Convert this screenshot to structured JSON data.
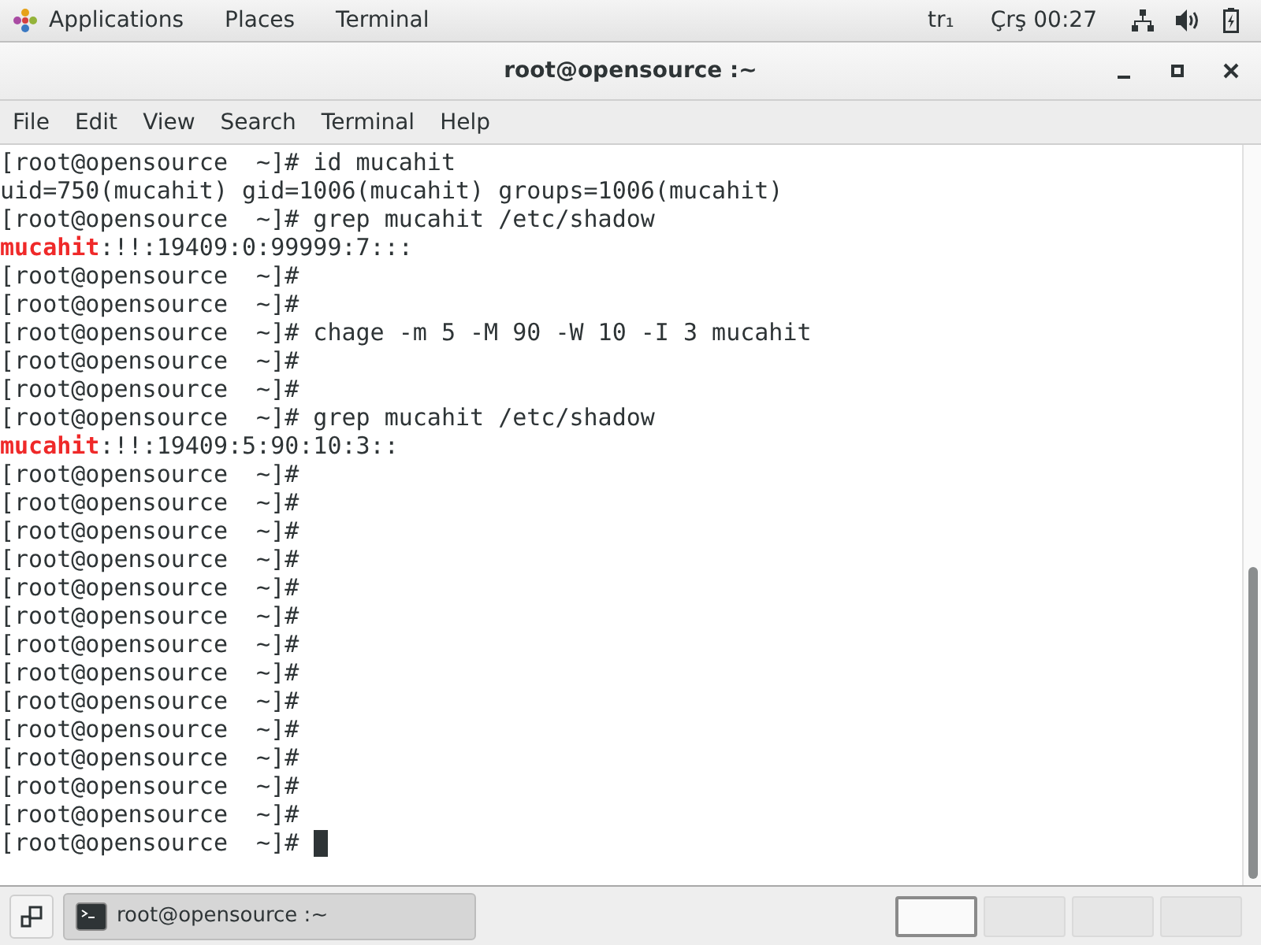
{
  "top_bar": {
    "menus": [
      "Applications",
      "Places",
      "Terminal"
    ],
    "keyboard": "tr₁",
    "clock": "Çrş 00:27"
  },
  "window": {
    "title": "root@opensource :~"
  },
  "menu_bar": [
    "File",
    "Edit",
    "View",
    "Search",
    "Terminal",
    "Help"
  ],
  "terminal": {
    "lines": [
      {
        "kind": "plain",
        "text": "[root@opensource  ~]# id mucahit"
      },
      {
        "kind": "plain",
        "text": "uid=750(mucahit) gid=1006(mucahit) groups=1006(mucahit)"
      },
      {
        "kind": "plain",
        "text": "[root@opensource  ~]# grep mucahit /etc/shadow"
      },
      {
        "kind": "match",
        "match": "mucahit",
        "text": ":!!:19409:0:99999:7:::"
      },
      {
        "kind": "plain",
        "text": "[root@opensource  ~]#"
      },
      {
        "kind": "plain",
        "text": "[root@opensource  ~]#"
      },
      {
        "kind": "plain",
        "text": "[root@opensource  ~]# chage -m 5 -M 90 -W 10 -I 3 mucahit"
      },
      {
        "kind": "plain",
        "text": "[root@opensource  ~]#"
      },
      {
        "kind": "plain",
        "text": "[root@opensource  ~]#"
      },
      {
        "kind": "plain",
        "text": "[root@opensource  ~]# grep mucahit /etc/shadow"
      },
      {
        "kind": "match",
        "match": "mucahit",
        "text": ":!!:19409:5:90:10:3::"
      },
      {
        "kind": "plain",
        "text": "[root@opensource  ~]#"
      },
      {
        "kind": "plain",
        "text": "[root@opensource  ~]#"
      },
      {
        "kind": "plain",
        "text": "[root@opensource  ~]#"
      },
      {
        "kind": "plain",
        "text": "[root@opensource  ~]#"
      },
      {
        "kind": "plain",
        "text": "[root@opensource  ~]#"
      },
      {
        "kind": "plain",
        "text": "[root@opensource  ~]#"
      },
      {
        "kind": "plain",
        "text": "[root@opensource  ~]#"
      },
      {
        "kind": "plain",
        "text": "[root@opensource  ~]#"
      },
      {
        "kind": "plain",
        "text": "[root@opensource  ~]#"
      },
      {
        "kind": "plain",
        "text": "[root@opensource  ~]#"
      },
      {
        "kind": "plain",
        "text": "[root@opensource  ~]#"
      },
      {
        "kind": "plain",
        "text": "[root@opensource  ~]#"
      },
      {
        "kind": "plain",
        "text": "[root@opensource  ~]#"
      },
      {
        "kind": "prompt",
        "text": "[root@opensource  ~]# "
      }
    ]
  },
  "taskbar": {
    "window_button": "root@opensource :~",
    "workspaces": [
      {
        "selected": true
      },
      {
        "selected": false
      },
      {
        "selected": false
      },
      {
        "selected": false
      }
    ]
  }
}
